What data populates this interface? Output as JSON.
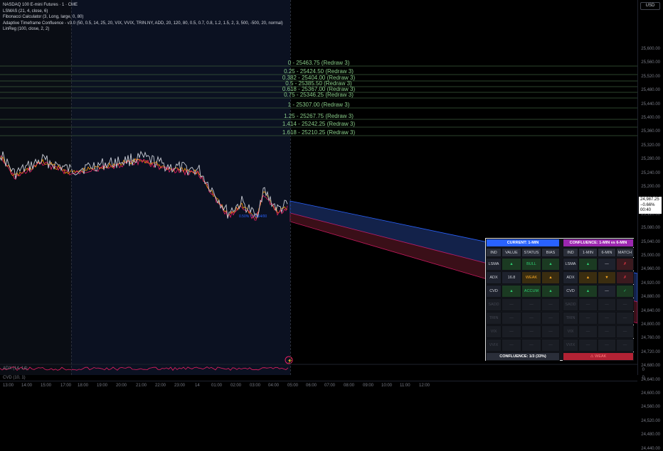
{
  "legend": {
    "title": "NASDAQ 100 E-mini Futures · 1 · CME",
    "lines": [
      "LSMAS (21, 4, close, 6)",
      "Fibonacci Calculator (3, Long, large, 0, 80)",
      "Adaptive Timeframe Confluence - v3.0 (50, 0.5, 14, 25, 20, VIX, VVIX, TRIN.NY, ADD, 20, 120, 80, 0.5, 0.7, 0.8, 1.2, 1.5, 2, 3, 500, -500, 20, normal)",
      "LinReg (100, close, 2, 2)"
    ]
  },
  "price_axis": {
    "currency": "USD",
    "labels": [
      "25,600.00",
      "25,560.00",
      "25,520.00",
      "25,480.00",
      "25,440.00",
      "25,400.00",
      "25,360.00",
      "25,320.00",
      "25,280.00",
      "25,240.00",
      "25,200.00",
      "25,160.00",
      "25,120.00",
      "25,080.00",
      "25,040.00",
      "25,000.00",
      "24,960.00",
      "24,920.00",
      "24,880.00",
      "24,840.00",
      "24,800.00",
      "24,760.00",
      "24,720.00",
      "24,680.00",
      "24,640.00",
      "24,600.00",
      "24,560.00",
      "24,520.00",
      "24,480.00",
      "24,440.00"
    ],
    "last_price": "24,987.25",
    "change": "−0.66%",
    "countdown": "00:40"
  },
  "time_axis": [
    "13:00",
    "14:00",
    "15:00",
    "17:00",
    "18:00",
    "19:00",
    "20:00",
    "21:00",
    "22:00",
    "23:00",
    "14",
    "01:00",
    "02:00",
    "03:00",
    "04:00",
    "05:00",
    "06:00",
    "07:00",
    "08:00",
    "09:00",
    "10:00",
    "11:00",
    "12:00"
  ],
  "fib_levels": [
    "0 - 25463.75 (Redraw 3)",
    "0.25 - 25424.50 (Redraw 3)",
    "0.382 - 25404.00 (Redraw 3)",
    "0.5 - 25385.50 (Redraw 3)",
    "0.618 - 25367.00 (Redraw 3)",
    "0.75 - 25346.25 (Redraw 3)",
    "1 - 25307.00 (Redraw 3)",
    "1.25 - 25267.75 (Redraw 3)",
    "1.414 - 25242.25 (Redraw 3)",
    "1.618 - 25210.25 (Redraw 3)"
  ],
  "indicators": {
    "adx_label": "ADX (14, 14)",
    "cvd_label": "CVD (10, 1)",
    "adx_scale": "0",
    "cvd_scale": "0"
  },
  "chart_note": "0.50% 714164/00",
  "panel": {
    "left_title": "CURRENT: 1-MIN",
    "right_title": "CONFLUENCE: 1-MIN vs 6-MIN",
    "left_cols": [
      "IND",
      "VALUE",
      "STATUS",
      "BIAS"
    ],
    "right_cols": [
      "IND",
      "1-MIN",
      "6-MIN",
      "MATCH"
    ],
    "rows": [
      {
        "ind": "LSMA",
        "value": "▲",
        "status": "BULL",
        "bias": "▲",
        "m1": "▲",
        "m6": "—",
        "match": "✗"
      },
      {
        "ind": "ADX",
        "value": "16.8",
        "status": "WEAK",
        "bias": "▲",
        "m1": "▲",
        "m6": "▼",
        "match": "✗"
      },
      {
        "ind": "CVD",
        "value": "▲",
        "status": "ACCUM",
        "bias": "▲",
        "m1": "▲",
        "m6": "—",
        "match": "✓"
      }
    ],
    "dim_rows": [
      {
        "ind": "SADD",
        "value": "—",
        "status": "—",
        "bias": "—",
        "m1": "—",
        "m6": "—",
        "match": "—"
      },
      {
        "ind": "TRIN",
        "value": "—",
        "status": "—",
        "bias": "—",
        "m1": "—",
        "m6": "—",
        "match": "—"
      },
      {
        "ind": "VIX",
        "value": "—",
        "status": "—",
        "bias": "—",
        "m1": "—",
        "m6": "—",
        "match": "—"
      },
      {
        "ind": "VVIX",
        "value": "—",
        "status": "—",
        "bias": "—",
        "m1": "—",
        "m6": "—",
        "match": "—"
      }
    ],
    "footer_left": "CONFLUENCE: 1/3 (33%)",
    "footer_right": "⚠ WEAK"
  },
  "colors": {
    "background": "#000000",
    "fib_line": "#3a5a3a",
    "fib_text": "#88cc88",
    "price_line": "#c9ccd6",
    "lsma_orange": "#ff9800",
    "lsma_red": "#e91e63",
    "channel_blue": "#1e3a78",
    "channel_red": "#6e1c2c",
    "panel_blue": "#2962ff",
    "panel_purple": "#9c27b0"
  }
}
